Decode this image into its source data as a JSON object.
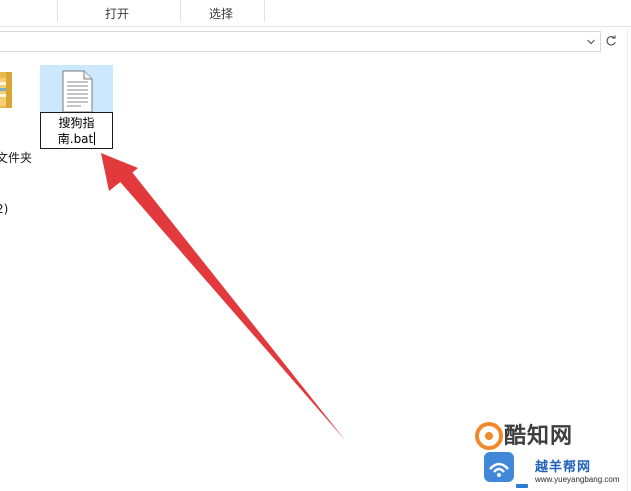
{
  "ribbon": {
    "open_group": "打开",
    "select_group": "选择"
  },
  "address_bar": {
    "dropdown_icon": "chevron-down-icon",
    "refresh_icon": "refresh-icon"
  },
  "items": {
    "folder": {
      "label_line1": "文件夹",
      "label_line2": "2)",
      "icon": "folder-icon"
    },
    "file": {
      "icon": "text-document-icon",
      "name_line1": "搜狗指",
      "name_line2": "南.bat",
      "state": "renaming",
      "highlight_color": "#cce8ff"
    }
  },
  "annotation": {
    "arrow_color": "#e23a3c",
    "points_to": "rename-box"
  },
  "watermark": {
    "logo_text": "酷知网",
    "site_name": "越羊帮网",
    "site_url": "www.yueyangbang.com",
    "brand_color": "#1f62b8"
  }
}
